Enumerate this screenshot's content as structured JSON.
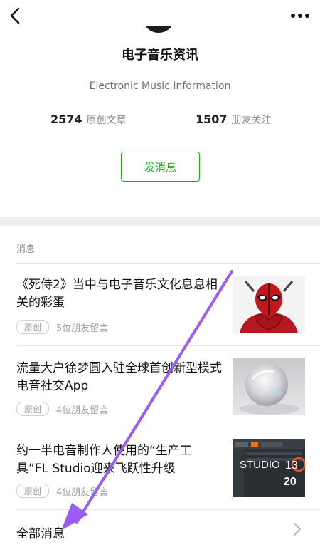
{
  "account": {
    "name": "电子音乐资讯",
    "subtitle": "Electronic Music Information",
    "stats": {
      "articles_count": "2574",
      "articles_label": "原创文章",
      "followers_count": "1507",
      "followers_label": "朋友关注"
    },
    "message_button": "发消息"
  },
  "messages": {
    "section_label": "消息",
    "items": [
      {
        "title": "《死侍2》当中与电子音乐文化息息相关的彩蛋",
        "tag": "原创",
        "comments": "5位朋友留言",
        "thumb": "deadpool-image"
      },
      {
        "title": "流量大户徐梦圆入驻全球首创新型模式电音社交App",
        "tag": "原创",
        "comments": "4位朋友留言",
        "thumb": "crystal-sphere-image"
      },
      {
        "title": "约一半电音制作人使用的“生产工具”FL Studio迎来飞跃性升级",
        "tag": "原创",
        "comments": "4位朋友留言",
        "thumb_text_1": "STUDIO",
        "thumb_text_2": "13",
        "thumb_text_3": "20",
        "thumb": "fl-studio-image"
      }
    ],
    "all_messages_label": "全部消息"
  },
  "icons": {
    "back": "back-arrow-icon",
    "more": "more-dots-icon",
    "chevron": "chevron-right-icon"
  },
  "colors": {
    "accent_green": "#1aad19",
    "annotation_purple": "#9b5cf6",
    "divider_band": "#efeff4"
  }
}
